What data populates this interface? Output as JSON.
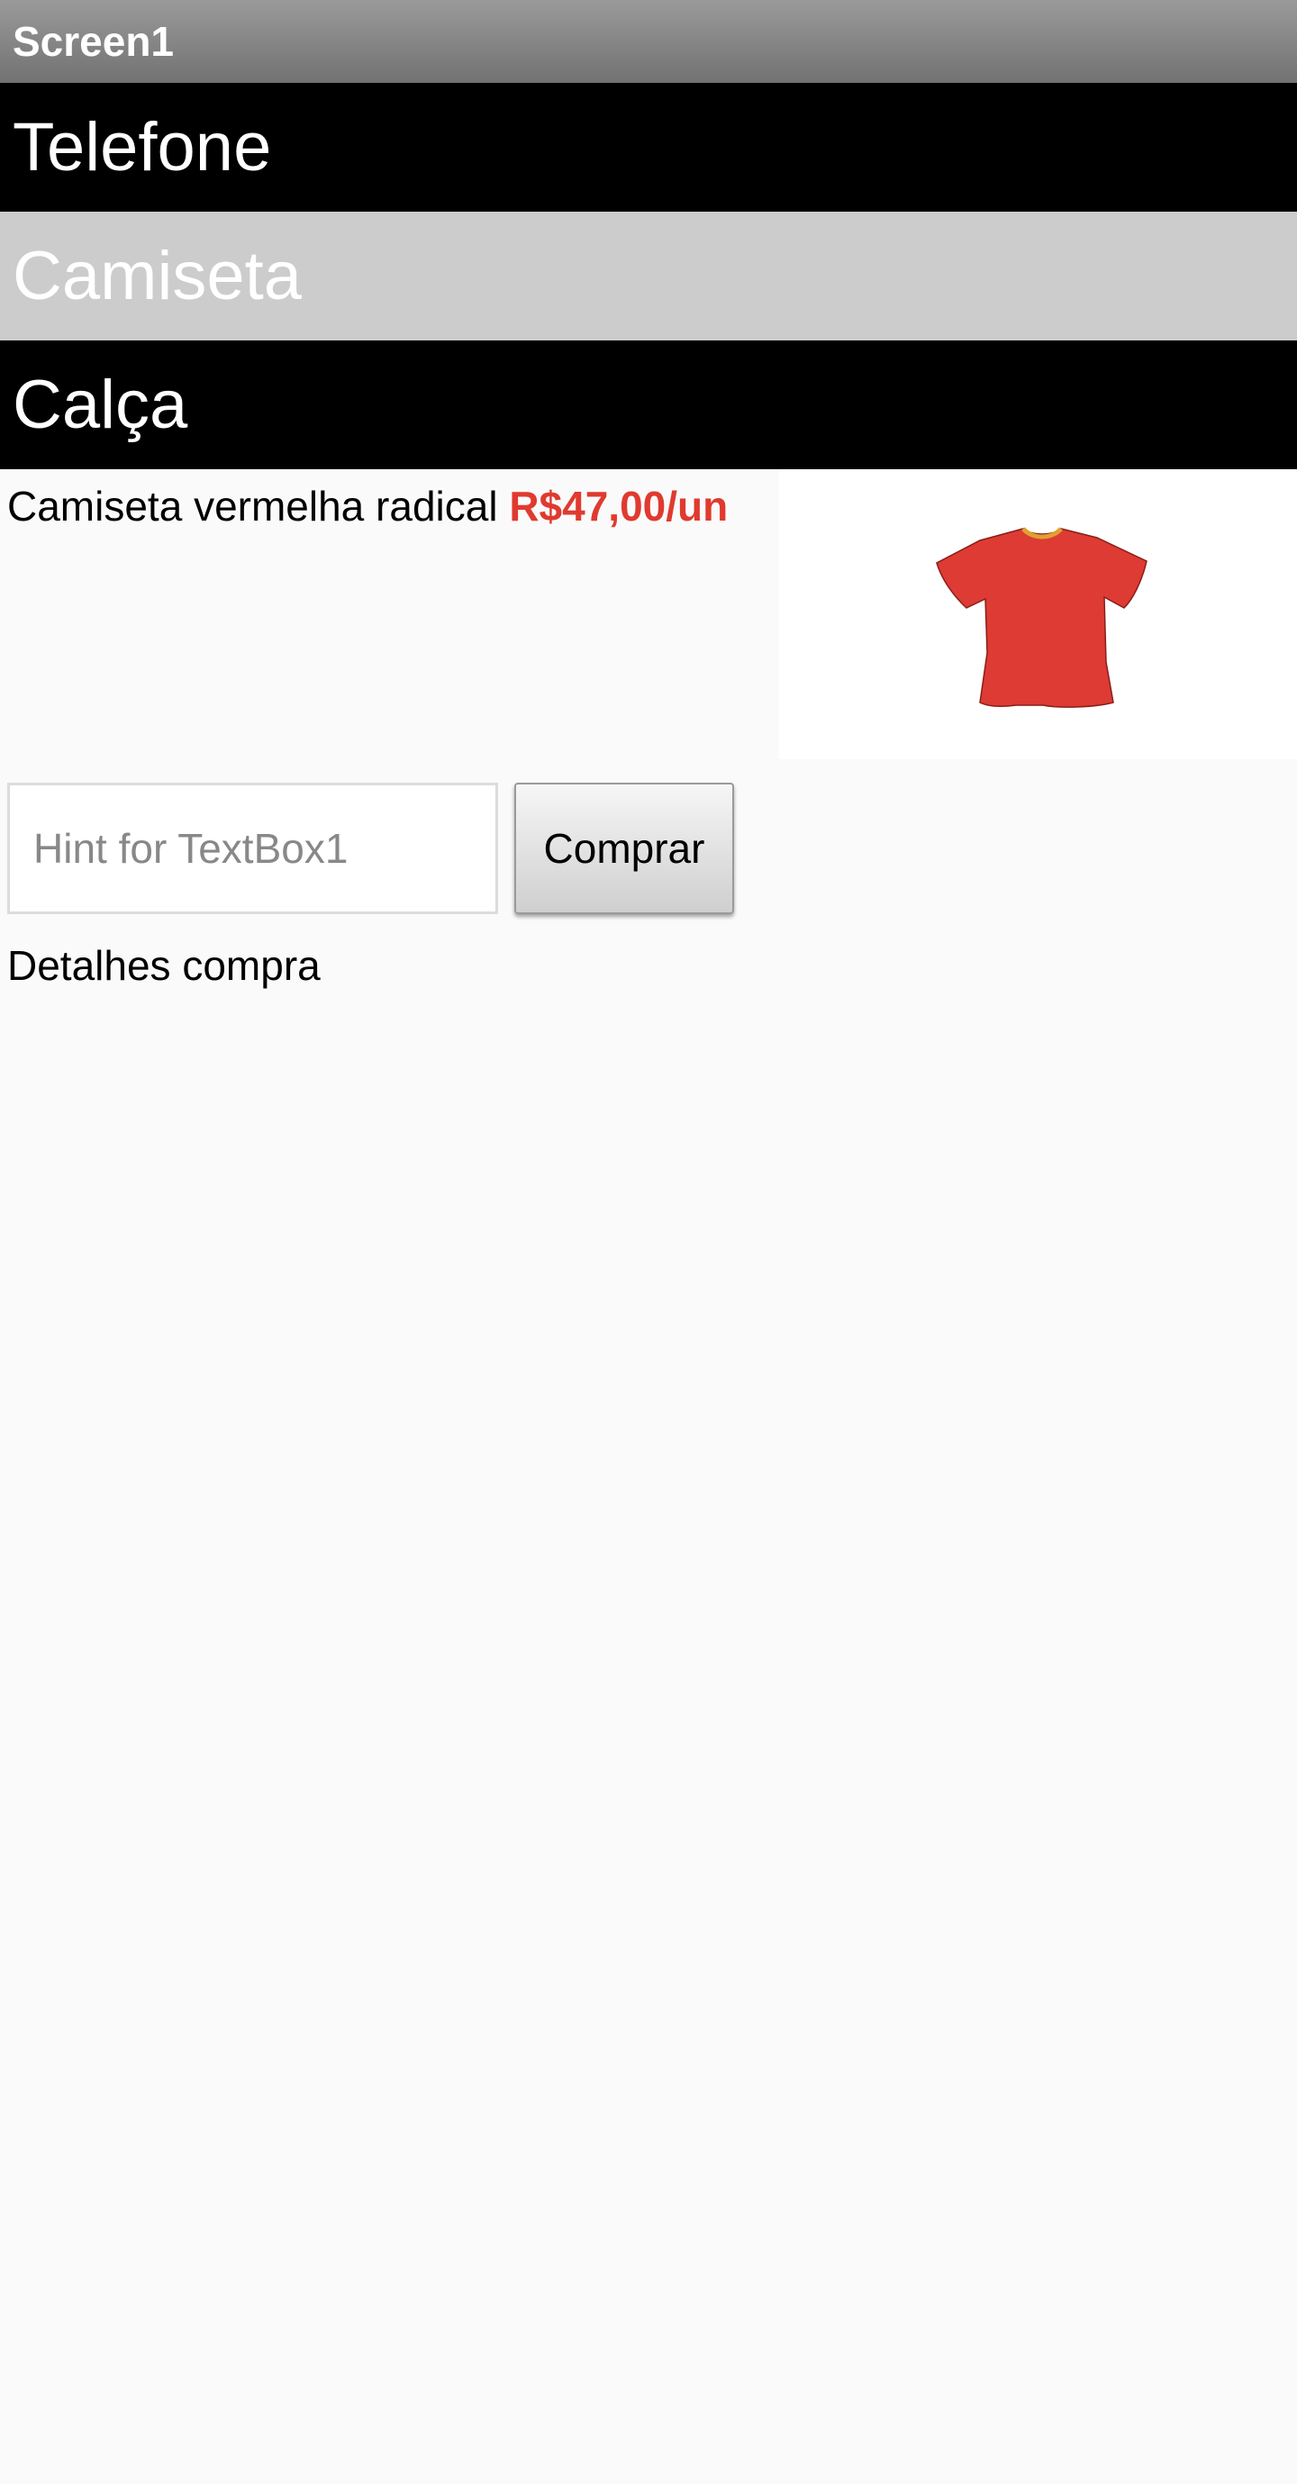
{
  "app": {
    "title": "Screen1"
  },
  "tabs": [
    {
      "label": "Telefone",
      "style": "dark"
    },
    {
      "label": "Camiseta",
      "style": "light"
    },
    {
      "label": "Calça",
      "style": "dark"
    }
  ],
  "product": {
    "description": "Camiseta vermelha radical",
    "price": "R$47,00/un",
    "price_color": "#e03a2f",
    "image_icon": "red-tshirt-icon"
  },
  "purchase": {
    "input_value": "",
    "input_placeholder": "Hint for TextBox1",
    "button_label": "Comprar"
  },
  "details": {
    "label": "Detalhes compra"
  }
}
